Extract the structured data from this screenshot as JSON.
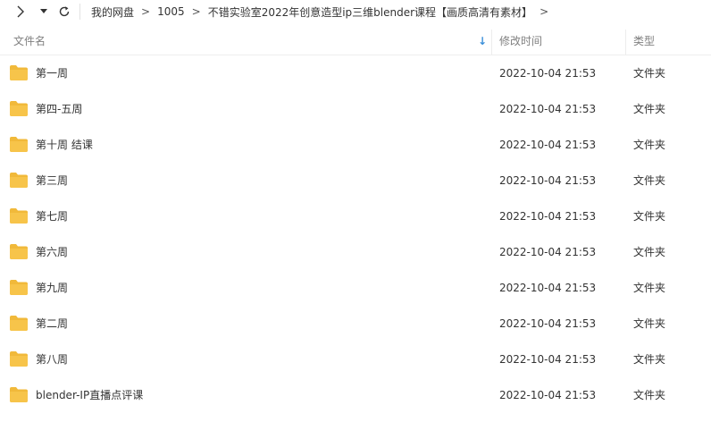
{
  "toolbar": {
    "forward_icon": "chevron-right-icon",
    "dropdown_icon": "caret-down-icon",
    "refresh_icon": "refresh-icon",
    "breadcrumbs": [
      "我的网盘",
      "1005",
      "不错实验室2022年创意造型ip三维blender课程【画质高清有素材】"
    ],
    "separator": ">"
  },
  "columns": {
    "name": "文件名",
    "modified": "修改时间",
    "type": "类型",
    "sort_icon": "sort-down-arrow-icon"
  },
  "rows": [
    {
      "name": "第一周",
      "modified": "2022-10-04 21:53",
      "type": "文件夹"
    },
    {
      "name": "第四-五周",
      "modified": "2022-10-04 21:53",
      "type": "文件夹"
    },
    {
      "name": "第十周 结课",
      "modified": "2022-10-04 21:53",
      "type": "文件夹"
    },
    {
      "name": "第三周",
      "modified": "2022-10-04 21:53",
      "type": "文件夹"
    },
    {
      "name": "第七周",
      "modified": "2022-10-04 21:53",
      "type": "文件夹"
    },
    {
      "name": "第六周",
      "modified": "2022-10-04 21:53",
      "type": "文件夹"
    },
    {
      "name": "第九周",
      "modified": "2022-10-04 21:53",
      "type": "文件夹"
    },
    {
      "name": "第二周",
      "modified": "2022-10-04 21:53",
      "type": "文件夹"
    },
    {
      "name": "第八周",
      "modified": "2022-10-04 21:53",
      "type": "文件夹"
    },
    {
      "name": "blender-IP直播点评课",
      "modified": "2022-10-04 21:53",
      "type": "文件夹"
    }
  ],
  "colors": {
    "folder": "#f7c44a",
    "folder_tab": "#f1b93a",
    "sort_arrow": "#3b8fd9",
    "header_text": "#7f7f7f"
  }
}
